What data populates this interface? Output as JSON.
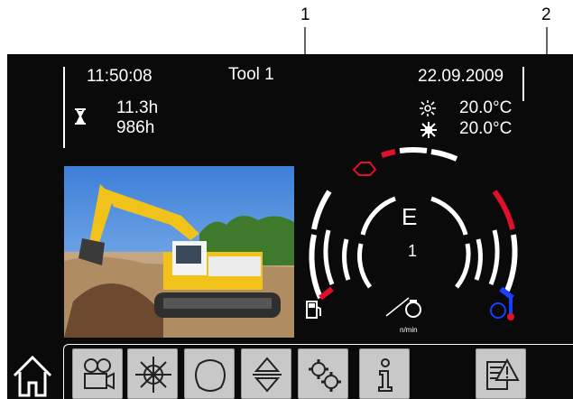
{
  "callouts": {
    "one": "1",
    "two": "2"
  },
  "status": {
    "time": "11:50:08",
    "tool": "Tool  1",
    "date": "22.09.2009",
    "hours_trip": "11.3h",
    "hours_total": "986h",
    "outside_temp": "20.0°C",
    "cabin_temp": "20.0°C"
  },
  "gauge": {
    "gear_letter": "E",
    "gear_number": "1",
    "unit_label": "n/min"
  },
  "colors": {
    "screen_bg": "#0a0a0a",
    "warning_red": "#e0102a",
    "coolant_blue": "#1a3fff",
    "button_grey": "#c8c8c8"
  },
  "nav": {
    "buttons": [
      "home-icon",
      "camera-icon",
      "climate-icon",
      "engine-icon",
      "up-down-icon",
      "settings-icon",
      "info-icon",
      "warning-list-icon"
    ]
  }
}
